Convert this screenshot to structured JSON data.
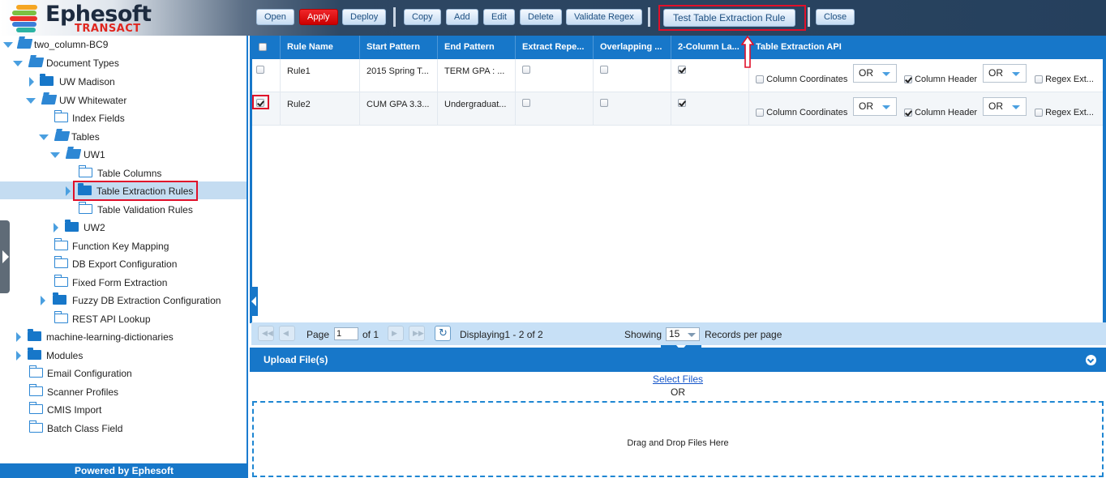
{
  "app": {
    "logo_name": "Ephesoft",
    "logo_product": "TRANSACT",
    "powered_by": "Powered by Ephesoft",
    "brand_color": "#1777c9"
  },
  "toolbar": {
    "open": "Open",
    "apply": "Apply",
    "deploy": "Deploy",
    "copy": "Copy",
    "add": "Add",
    "edit": "Edit",
    "delete": "Delete",
    "validate_regex": "Validate Regex",
    "test_rule": "Test Table Extraction Rule",
    "close": "Close"
  },
  "tree": {
    "root": "two_column-BC9",
    "document_types": "Document Types",
    "uw_madison": "UW Madison",
    "uw_whitewater": "UW Whitewater",
    "index_fields": "Index Fields",
    "tables": "Tables",
    "uw1": "UW1",
    "table_columns": "Table Columns",
    "table_extraction_rules": "Table Extraction Rules",
    "table_validation_rules": "Table Validation Rules",
    "uw2": "UW2",
    "function_key_mapping": "Function Key Mapping",
    "db_export_configuration": "DB Export Configuration",
    "fixed_form_extraction": "Fixed Form Extraction",
    "fuzzy_db_extraction_configuration": "Fuzzy DB Extraction Configuration",
    "rest_api_lookup": "REST API Lookup",
    "machine_learning_dictionaries": "machine-learning-dictionaries",
    "modules": "Modules",
    "email_configuration": "Email Configuration",
    "scanner_profiles": "Scanner Profiles",
    "cmis_import": "CMIS Import",
    "batch_class_field": "Batch Class Field"
  },
  "grid": {
    "columns": {
      "rule_name": "Rule Name",
      "start_pattern": "Start Pattern",
      "end_pattern": "End Pattern",
      "extract_repeated": "Extract Repe...",
      "overlapping": "Overlapping ...",
      "two_column": "2-Column La...",
      "api": "Table Extraction API"
    },
    "rows": [
      {
        "selected": false,
        "rule_name": "Rule1",
        "start_pattern": "2015 Spring T...",
        "end_pattern": "TERM GPA : ...",
        "extract_repeated": false,
        "overlapping": false,
        "two_column": true,
        "api": {
          "column_coordinates": "Column Coordinates",
          "column_coordinates_checked": false,
          "op1": "OR",
          "column_header": "Column Header",
          "column_header_checked": true,
          "op2": "OR",
          "regex_extraction": "Regex Ext...",
          "regex_checked": false
        }
      },
      {
        "selected": true,
        "rule_name": "Rule2",
        "start_pattern": "CUM GPA 3.3...",
        "end_pattern": "Undergraduat...",
        "extract_repeated": false,
        "overlapping": false,
        "two_column": true,
        "api": {
          "column_coordinates": "Column Coordinates",
          "column_coordinates_checked": false,
          "op1": "OR",
          "column_header": "Column Header",
          "column_header_checked": true,
          "op2": "OR",
          "regex_extraction": "Regex Ext...",
          "regex_checked": false
        }
      }
    ]
  },
  "pager": {
    "page_label": "Page",
    "page_value": "1",
    "of_label": "of 1",
    "displaying": "Displaying1 - 2 of 2",
    "showing_label": "Showing",
    "page_size": "15",
    "records_label": "Records per page"
  },
  "upload": {
    "title": "Upload File(s)",
    "select_files": "Select Files",
    "or": "OR",
    "drop_text": "Drag and Drop Files Here"
  }
}
